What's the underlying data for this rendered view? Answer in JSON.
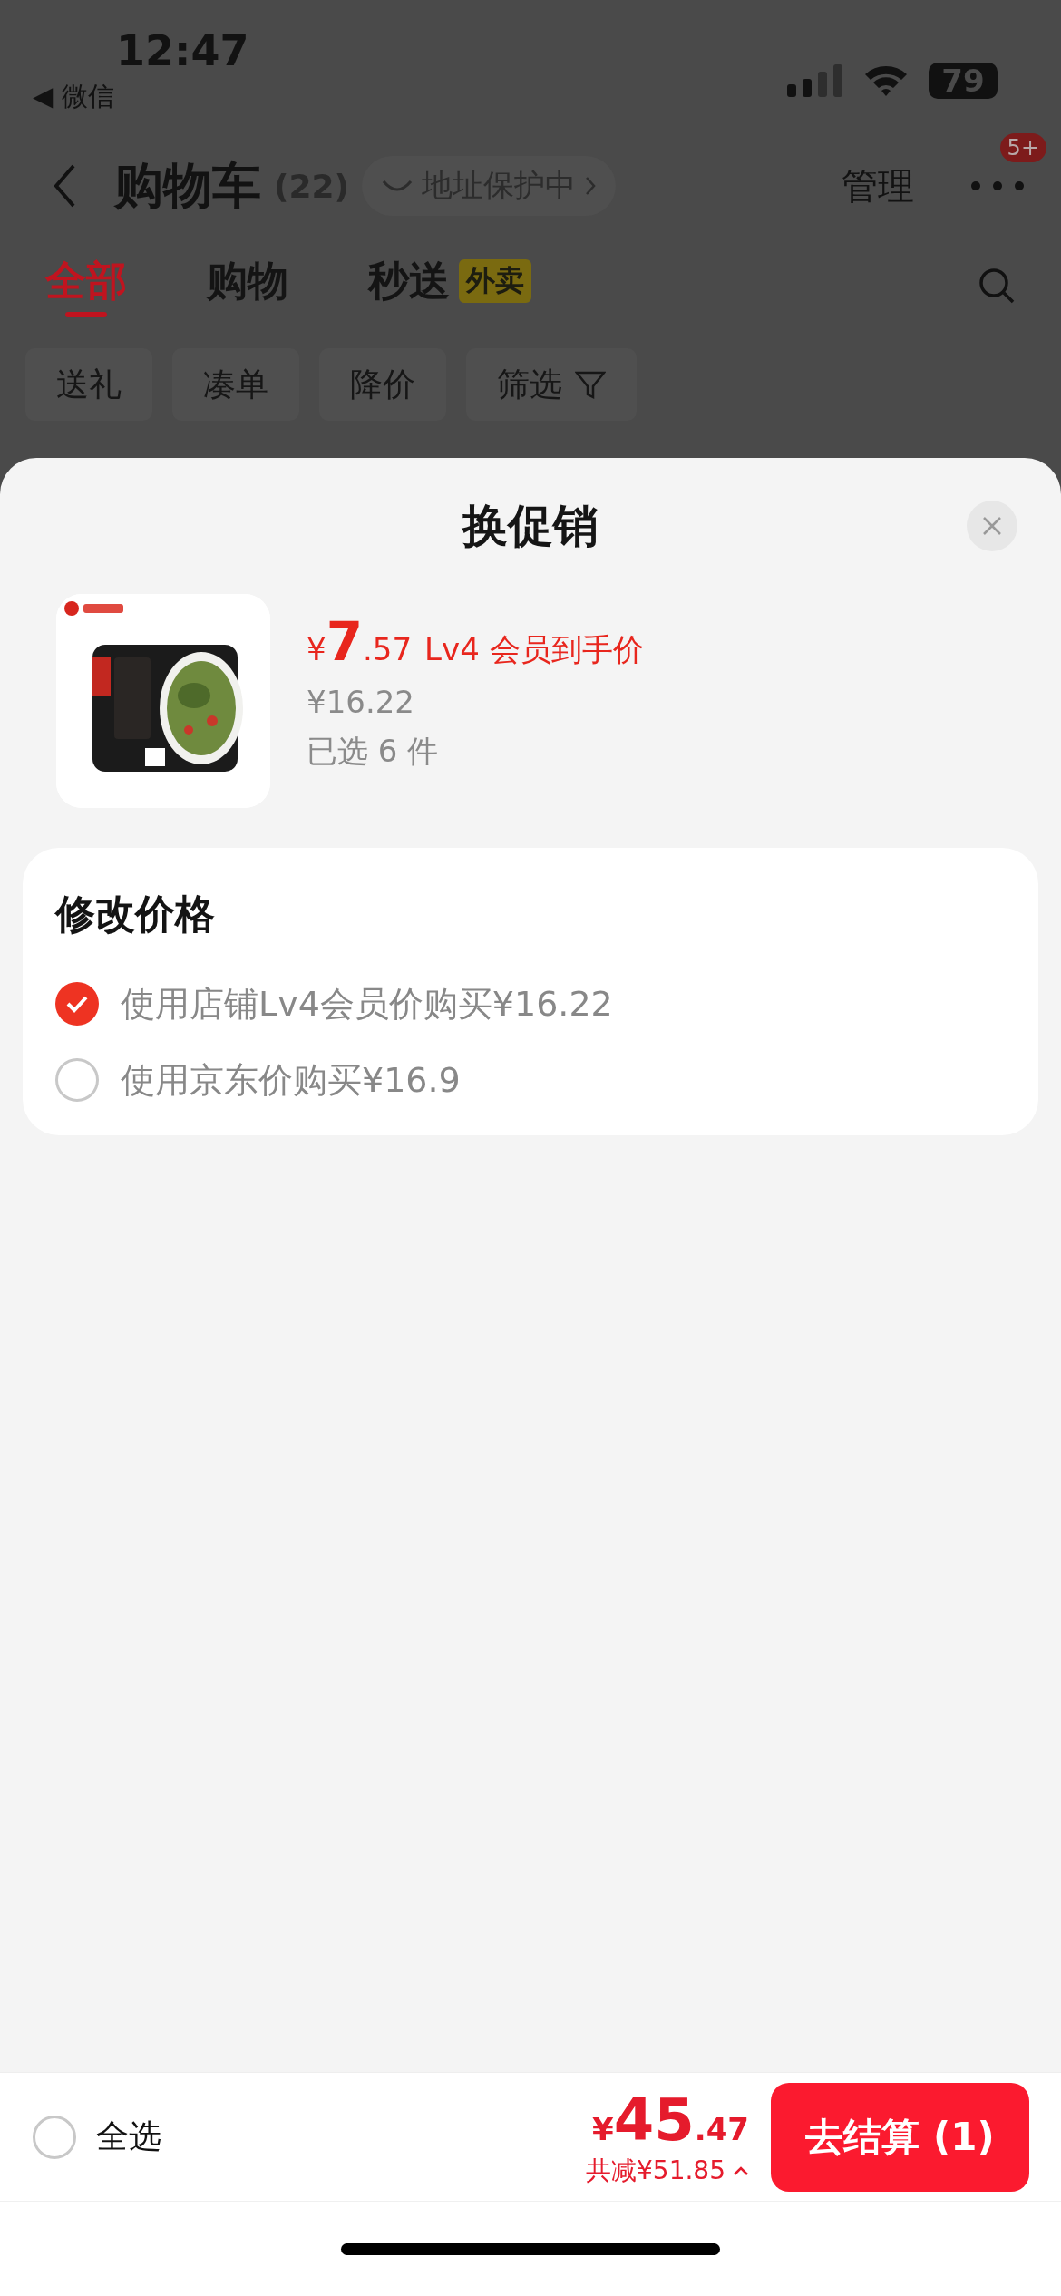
{
  "status_bar": {
    "time": "12:47",
    "back_app": "◀ 微信",
    "battery": "79"
  },
  "header": {
    "title": "购物车",
    "count": "(22)",
    "address_pill": "地址保护中",
    "manage": "管理",
    "badge": "5+"
  },
  "tabs": [
    {
      "label": "全部",
      "selected": true
    },
    {
      "label": "购物",
      "selected": false
    },
    {
      "label": "秒送",
      "tag": "外卖",
      "selected": false
    }
  ],
  "filters": [
    {
      "label": "送礼",
      "kind": "chip"
    },
    {
      "label": "凑单",
      "kind": "chip"
    },
    {
      "label": "降价",
      "kind": "chip"
    },
    {
      "label": "筛选",
      "kind": "filter"
    }
  ],
  "sheet": {
    "title": "换促销",
    "product": {
      "price_symbol": "¥",
      "price_int": "7",
      "price_dec": ".57",
      "price_note": "Lv4 会员到手价",
      "original_price": "¥16.22",
      "selected_count": "已选 6 件"
    },
    "price_card": {
      "title": "修改价格",
      "options": [
        {
          "label": "使用店铺Lv4会员价购买¥16.22",
          "selected": true
        },
        {
          "label": "使用京东价购买¥16.9",
          "selected": false
        }
      ]
    }
  },
  "bottom_bar": {
    "select_all": {
      "label": "全选",
      "checked": false
    },
    "total_symbol": "¥",
    "total_int": "45",
    "total_dec": ".47",
    "discount": "共减¥51.85",
    "checkout": "去结算 (1)"
  }
}
